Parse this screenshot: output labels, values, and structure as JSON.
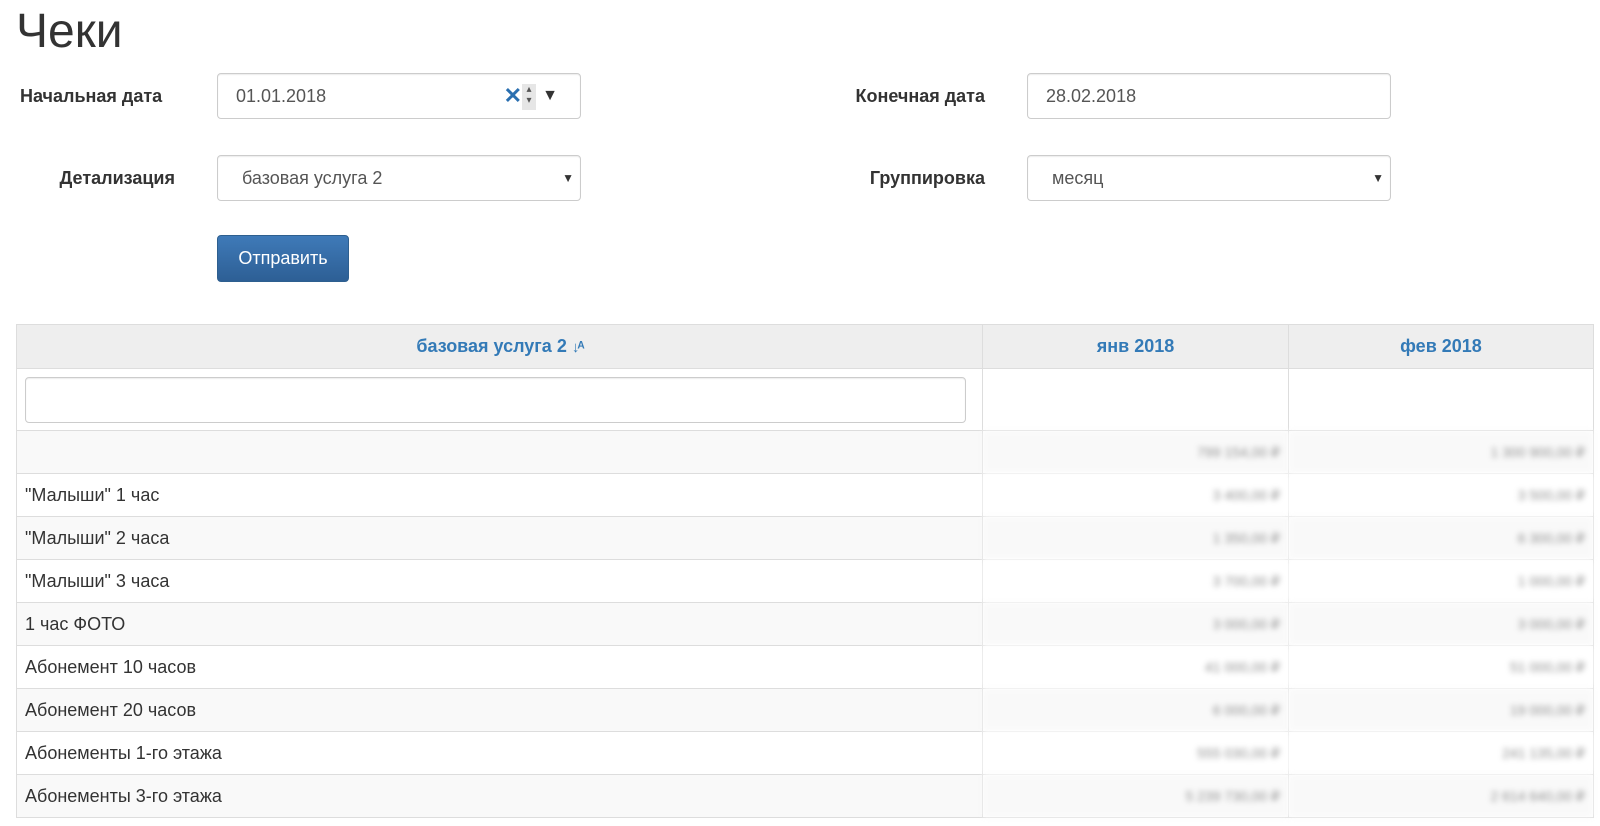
{
  "page": {
    "title": "Чеки"
  },
  "form": {
    "start_date": {
      "label": "Начальная дата",
      "value": "01.01.2018"
    },
    "end_date": {
      "label": "Конечная дата",
      "value": "28.02.2018"
    },
    "detail": {
      "label": "Детализация",
      "selected": "базовая услуга 2"
    },
    "grouping": {
      "label": "Группировка",
      "selected": "месяц"
    },
    "submit_label": "Отправить"
  },
  "icons": {
    "clear": "close-icon",
    "spinner": "spinner-arrows-icon",
    "dropdown": "triangle-down-icon",
    "select_caret": "caret-down-icon",
    "sort": "sort-alpha-icon"
  },
  "table": {
    "columns": [
      "базовая услуга 2",
      "янв 2018",
      "фев 2018"
    ],
    "total_row": {
      "jan": "799 154,00 ₽",
      "feb": "1 300 900,00 ₽"
    },
    "rows": [
      {
        "name": "\"Малыши\" 1 час",
        "jan": "3 400,00 ₽",
        "feb": "3 500,00 ₽"
      },
      {
        "name": "\"Малыши\" 2 часа",
        "jan": "1 350,00 ₽",
        "feb": "6 300,00 ₽"
      },
      {
        "name": "\"Малыши\" 3 часа",
        "jan": "3 700,00 ₽",
        "feb": "1 000,00 ₽"
      },
      {
        "name": "1 час ФОТО",
        "jan": "3 000,00 ₽",
        "feb": "3 000,00 ₽"
      },
      {
        "name": "Абонемент 10 часов",
        "jan": "41 000,00 ₽",
        "feb": "51 000,00 ₽"
      },
      {
        "name": "Абонемент 20 часов",
        "jan": "6 000,00 ₽",
        "feb": "19 000,00 ₽"
      },
      {
        "name": "Абонементы 1-го этажа",
        "jan": "555 030,00 ₽",
        "feb": "241 135,00 ₽"
      },
      {
        "name": "Абонементы 3-го этажа",
        "jan": "5 239 730,00 ₽",
        "feb": "2 614 640,00 ₽"
      }
    ]
  },
  "colors": {
    "link_blue": "#337ab7",
    "button_blue": "#2d5f95",
    "header_bg": "#eeeeee",
    "stripe_bg": "#f9f9f9"
  }
}
